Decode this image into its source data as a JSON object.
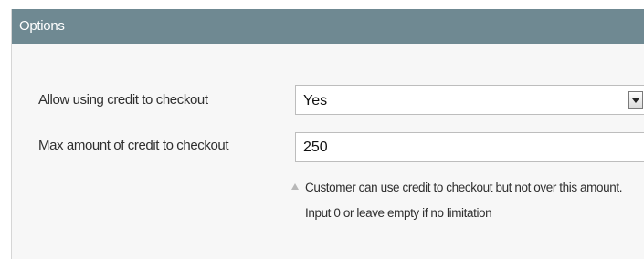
{
  "section": {
    "title": "Options"
  },
  "fields": {
    "allow_credit": {
      "label": "Allow using credit to checkout",
      "value": "Yes"
    },
    "max_amount": {
      "label": "Max amount of credit to checkout",
      "value": "250",
      "note": "Customer can use credit to checkout but not over this amount. Input 0 or leave empty if no limitation"
    }
  },
  "icons": {
    "select_arrow": "chevron-down-icon",
    "note": "triangle-up-icon"
  },
  "colors": {
    "header_bg": "#6f8992",
    "panel_bg": "#f7f7f7",
    "text": "#2f2f2f"
  }
}
